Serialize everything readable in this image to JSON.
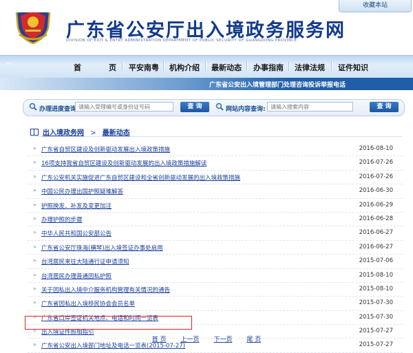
{
  "favorite": "收藏本站",
  "site": {
    "title": "广东省公安厅出入境政务服务网",
    "subtitle": "DIVISION OF EXIT & ENTRY ADMINISTRATION DEPARTMENT OF PUBLIC SECURITY OF GUANGDONG PROVINCE"
  },
  "nav": {
    "items": [
      "首",
      "页",
      "平安南粤",
      "机构介绍",
      "最新动态",
      "办事指南",
      "法律法规",
      "证件知识"
    ]
  },
  "ribbon": "广东省公安出入境管理部门处理咨询投诉举报电话",
  "search": {
    "progress_label": "办理进度查询:",
    "progress_placeholder": "请输入受理编号或身份证号码",
    "site_label": "网站内容查询:",
    "site_placeholder": "请输入搜索内容",
    "button": "查 询"
  },
  "breadcrumb": {
    "root": "出入境政务网",
    "sep": ">",
    "current": "最新动态"
  },
  "news": [
    {
      "title": "广东省自贸区建设及创新驱动发展出入境政策措施",
      "date": "2016-08-10"
    },
    {
      "title": "16项支持我省自贸区建设及创新驱动发展的出入境政策措施解读",
      "date": "2016-07-26"
    },
    {
      "title": "广东公安机关实施促进广东自贸区建设和全省创新驱动发展的出入境政策措施",
      "date": "2016-07-26"
    },
    {
      "title": "中国公民办理出国护照疑难解答",
      "date": "2016-06-30"
    },
    {
      "title": "护照换发、补发及变更加注",
      "date": "2016-06-29"
    },
    {
      "title": "办理护照的步骤",
      "date": "2016-06-28"
    },
    {
      "title": "中华人民共和国公安部公告",
      "date": "2016-06-27"
    },
    {
      "title": "广东省公安厅珠海(横琴)出入境签证办事处启用",
      "date": "2016-06-27"
    },
    {
      "title": "台湾居民来往大陆通行证申请须知",
      "date": "2015-07-06"
    },
    {
      "title": "台湾居民办理普通因私护照",
      "date": "2015-08-10"
    },
    {
      "title": "关于因私出入境中介服务机构管理有关情况的通告",
      "date": "2015-08-10"
    },
    {
      "title": "广东省因私出入境移民协会会员名单",
      "date": "2015-07-30"
    },
    {
      "title": "广东省口岸签证机关地点、电话和时间一览表",
      "date": "2015-07-30"
    },
    {
      "title": "出入境证件照相指引",
      "date": "2015-07-27"
    },
    {
      "title": "广东省公安出入境部门地址及电话一览表(2015-07-27)",
      "date": "2015-07-27"
    }
  ],
  "pager": {
    "first": "首 页",
    "prev": "上一页",
    "next": "下一页",
    "last": "尾 页"
  },
  "colors": {
    "brand_blue": "#123a8c",
    "link": "#1a3e9a",
    "button": "#1d56a0",
    "highlight": "#e02020"
  }
}
